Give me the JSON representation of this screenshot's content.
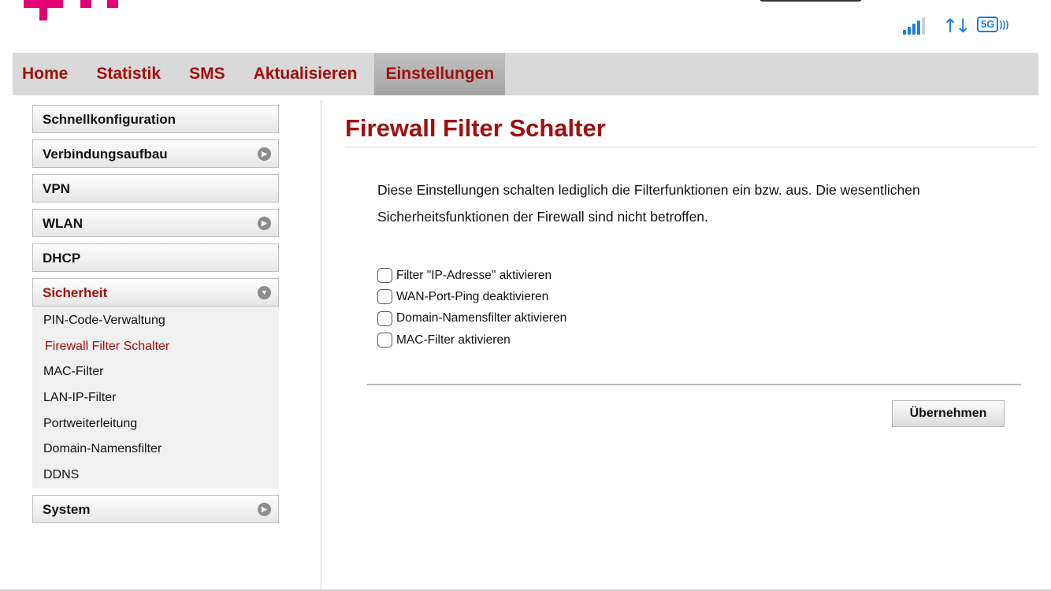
{
  "colors": {
    "brand_magenta": "#e20074",
    "accent_red": "#a00f0f",
    "status_blue": "#1d7ed8"
  },
  "header": {
    "status_icons": [
      "signal-strength-icon",
      "data-transfer-icon",
      "5g-wifi-icon"
    ],
    "network_badge": "5G"
  },
  "nav": {
    "items": [
      {
        "label": "Home"
      },
      {
        "label": "Statistik"
      },
      {
        "label": "SMS"
      },
      {
        "label": "Aktualisieren"
      },
      {
        "label": "Einstellungen",
        "active": true
      }
    ]
  },
  "sidebar": {
    "items": [
      {
        "label": "Schnellkonfiguration"
      },
      {
        "label": "Verbindungsaufbau",
        "icon": "arrow-right-circle-icon"
      },
      {
        "label": "VPN"
      },
      {
        "label": "WLAN",
        "icon": "arrow-right-circle-icon"
      },
      {
        "label": "DHCP"
      },
      {
        "label": "Sicherheit",
        "icon": "arrow-down-circle-icon",
        "active": true,
        "subitems": [
          {
            "label": "PIN-Code-Verwaltung"
          },
          {
            "label": "Firewall Filter Schalter",
            "active": true
          },
          {
            "label": "MAC-Filter"
          },
          {
            "label": "LAN-IP-Filter"
          },
          {
            "label": "Portweiterleitung"
          },
          {
            "label": "Domain-Namensfilter"
          },
          {
            "label": "DDNS"
          }
        ]
      },
      {
        "label": "System",
        "icon": "arrow-right-circle-icon"
      }
    ]
  },
  "main": {
    "title": "Firewall Filter Schalter",
    "description": "Diese Einstellungen schalten lediglich die Filterfunktionen ein bzw. aus. Die wesentlichen Sicherheitsfunktionen der Firewall sind nicht betroffen.",
    "checkboxes": [
      {
        "label": "Filter \"IP-Adresse\" aktivieren",
        "checked": false
      },
      {
        "label": "WAN-Port-Ping deaktivieren",
        "checked": false
      },
      {
        "label": "Domain-Namensfilter aktivieren",
        "checked": false
      },
      {
        "label": "MAC-Filter aktivieren",
        "checked": false
      }
    ],
    "apply_label": "Übernehmen"
  }
}
